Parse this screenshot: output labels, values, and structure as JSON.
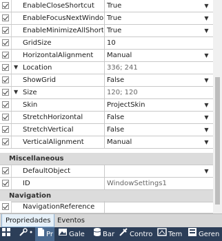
{
  "properties": {
    "rows": [
      {
        "name": "EnableCloseShortcut",
        "value": "True",
        "dropdown": true
      },
      {
        "name": "EnableFocusNextWindowShortcut",
        "value": "True",
        "dropdown": true
      },
      {
        "name": "EnableMinimizeAllShortcut",
        "value": "True",
        "dropdown": true
      },
      {
        "name": "GridSize",
        "value": "10"
      },
      {
        "name": "HorizontalAlignment",
        "value": "Manual",
        "dropdown": true
      },
      {
        "name": "Location",
        "value": "336; 241",
        "expandable": true
      },
      {
        "name": "ShowGrid",
        "value": "False",
        "dropdown": true
      },
      {
        "name": "Size",
        "value": "120; 120",
        "expandable": true
      },
      {
        "name": "Skin",
        "value": "ProjectSkin",
        "dropdown": true
      },
      {
        "name": "StretchHorizontal",
        "value": "False",
        "dropdown": true
      },
      {
        "name": "StretchVertical",
        "value": "False",
        "dropdown": true
      },
      {
        "name": "VerticalAlignment",
        "value": "Manual",
        "dropdown": true
      }
    ],
    "misc_category": "Miscellaneous",
    "misc_rows": [
      {
        "name": "DefaultObject",
        "value": "",
        "dropdown": true
      },
      {
        "name": "ID",
        "value": "WindowSettings1"
      }
    ],
    "nav_category": "Navigation",
    "nav_rows": [
      {
        "name": "NavigationReference",
        "value": ""
      }
    ]
  },
  "tabs": {
    "properties": "Propriedades",
    "events": "Eventos"
  },
  "toolbar": {
    "items": [
      "Pr",
      "Gale",
      "Bar",
      "Contro",
      "Tem",
      "Geren"
    ]
  }
}
